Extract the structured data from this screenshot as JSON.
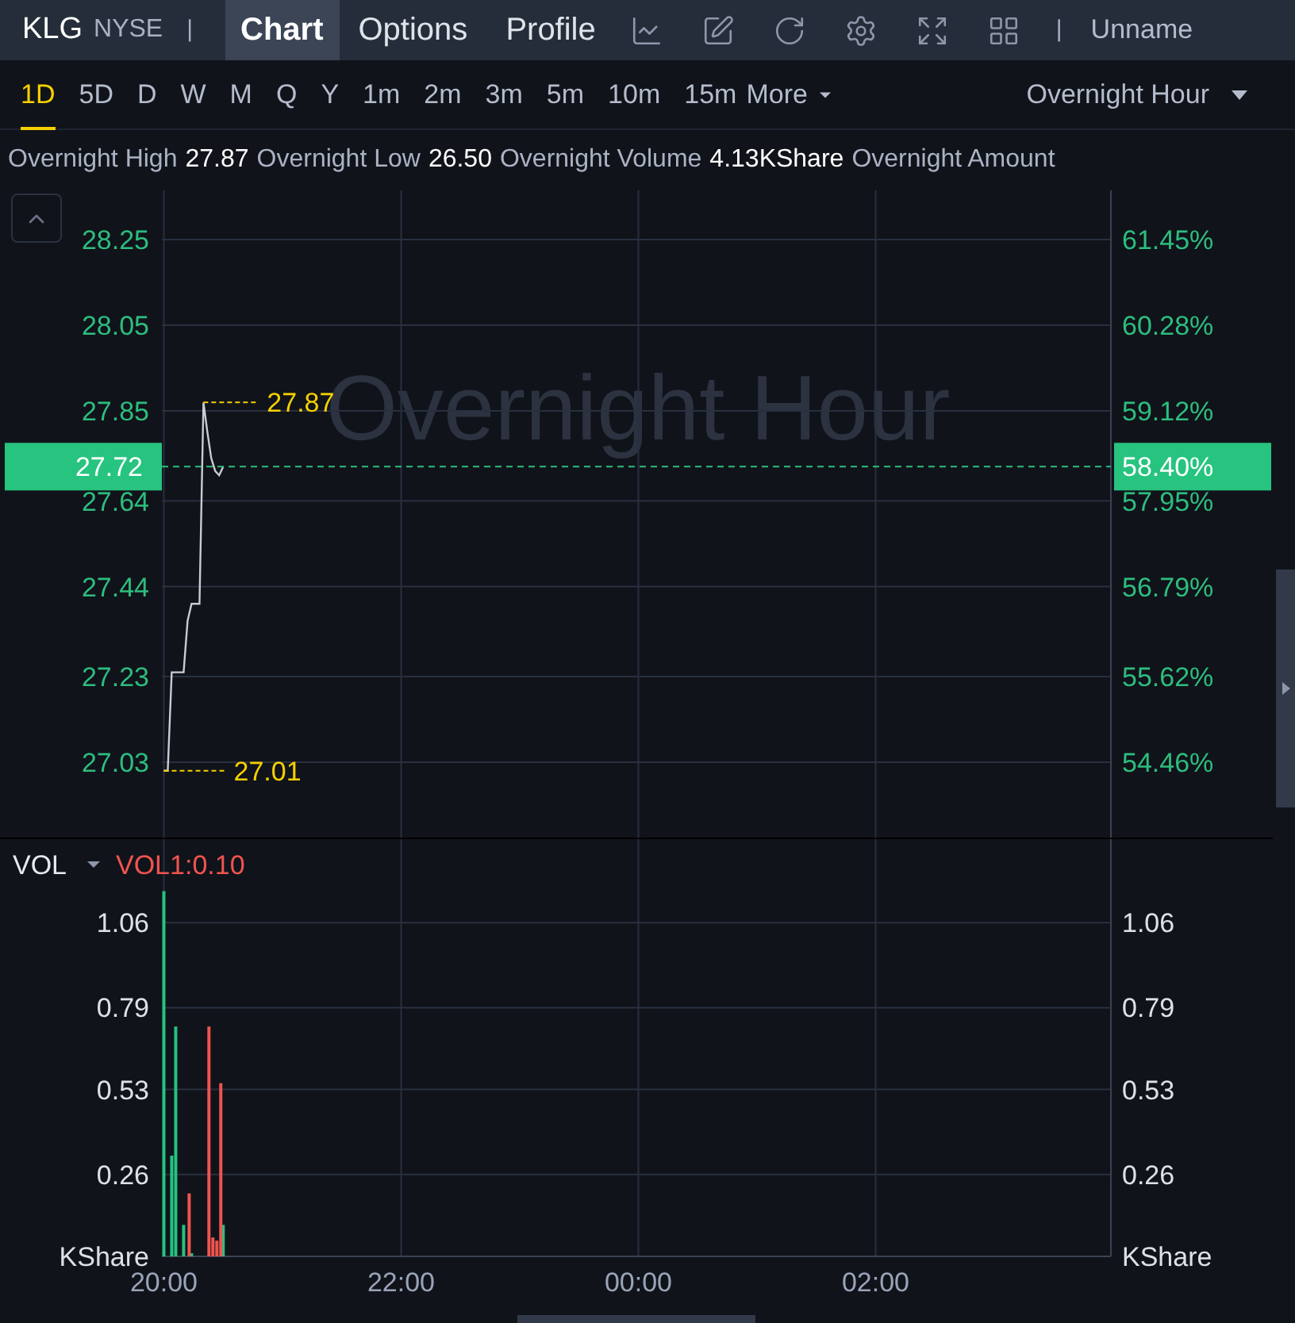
{
  "header": {
    "symbol": "KLG",
    "exchange": "NYSE",
    "separator": "|",
    "tabs": [
      {
        "label": "Chart",
        "selected": true
      },
      {
        "label": "Options",
        "selected": false
      },
      {
        "label": "Profile",
        "selected": false
      }
    ],
    "separator_2": "|",
    "layout_name": "Unname"
  },
  "periods": [
    {
      "label": "1D",
      "selected": true
    },
    {
      "label": "5D",
      "selected": false
    },
    {
      "label": "D",
      "selected": false
    },
    {
      "label": "W",
      "selected": false
    },
    {
      "label": "M",
      "selected": false
    },
    {
      "label": "Q",
      "selected": false
    },
    {
      "label": "Y",
      "selected": false
    },
    {
      "label": "1m",
      "selected": false
    },
    {
      "label": "2m",
      "selected": false
    },
    {
      "label": "3m",
      "selected": false
    },
    {
      "label": "5m",
      "selected": false
    },
    {
      "label": "10m",
      "selected": false
    },
    {
      "label": "15m",
      "selected": false
    }
  ],
  "more": {
    "label": "More"
  },
  "session_select": {
    "value": "Overnight Hour"
  },
  "stats": [
    {
      "label": "Overnight High",
      "value": "27.87"
    },
    {
      "label": "Overnight Low",
      "value": "26.50"
    },
    {
      "label": "Overnight Volume",
      "value": "4.13KShare"
    },
    {
      "label": "Overnight Amount"
    }
  ],
  "price_panel": {
    "watermark": "Overnight Hour",
    "percent_labels": [
      "61.45%",
      "60.28%",
      "59.12%",
      "57.95%",
      "56.79%",
      "55.62%",
      "54.46%"
    ],
    "chart_data": {
      "type": "line",
      "categories": [
        null,
        null,
        null,
        null,
        null,
        null,
        null,
        null,
        null,
        null,
        null,
        null,
        null,
        null,
        null,
        null,
        null,
        null,
        null,
        null,
        null,
        null,
        null,
        null,
        null,
        null,
        null,
        null,
        null,
        null,
        null,
        null,
        null,
        null,
        null,
        null,
        null,
        null,
        null,
        null,
        null,
        null,
        null,
        null,
        null,
        null,
        null,
        null,
        null,
        null,
        null,
        null,
        null,
        null,
        null,
        null,
        null,
        null,
        null,
        null,
        null,
        null,
        null,
        null,
        null,
        null,
        null,
        null,
        null,
        null,
        null,
        null,
        null,
        null,
        null,
        null,
        null,
        null,
        null,
        null,
        null,
        null,
        null,
        null,
        null,
        null,
        null,
        null,
        null,
        null,
        null,
        null,
        null,
        null,
        null,
        null,
        null,
        null,
        null,
        null,
        null,
        null,
        null,
        null,
        null,
        null,
        null,
        null,
        null,
        null,
        null,
        null,
        null,
        null,
        null,
        null,
        null,
        null,
        null,
        null,
        null,
        null,
        null,
        null,
        null,
        null,
        null,
        null,
        null,
        null,
        null,
        null,
        null,
        null,
        null,
        null,
        null,
        null,
        null,
        null,
        null,
        null,
        null,
        null,
        null,
        null,
        null,
        null,
        null,
        null,
        null,
        null,
        null,
        null,
        null,
        null,
        null,
        null,
        null,
        null,
        null,
        null,
        null,
        null,
        null,
        null,
        null,
        null,
        null,
        null,
        null,
        null,
        null,
        null,
        null,
        null,
        null,
        null,
        null,
        null,
        null,
        null,
        null,
        null,
        null,
        null,
        null,
        null,
        null,
        null,
        null,
        null,
        null,
        null,
        null,
        null,
        null,
        null,
        null,
        null,
        null,
        null,
        null,
        null,
        null,
        null,
        null,
        null,
        null,
        null,
        null,
        null,
        null,
        null,
        null,
        null,
        null,
        null,
        null,
        null,
        null,
        null,
        null,
        null,
        null,
        null,
        null,
        null,
        null,
        null,
        null,
        null,
        null,
        null,
        null,
        null,
        null,
        null,
        null,
        null
      ],
      "series": [
        {
          "color": "#c8ccd4",
          "values": [
            27.01,
            27.01,
            27.24,
            27.24,
            27.24,
            27.24,
            27.36,
            27.4,
            27.4,
            27.4,
            27.87,
            27.8,
            27.74,
            27.71,
            27.7,
            27.72,
            null,
            null,
            null,
            null,
            null,
            null,
            null,
            null,
            null,
            null,
            null,
            null,
            null,
            null,
            null,
            null,
            null,
            null,
            null,
            null,
            null,
            null,
            null,
            null,
            null,
            null,
            null,
            null,
            null,
            null,
            null,
            null,
            null,
            null,
            null,
            null,
            null,
            null,
            null,
            null,
            null,
            null,
            null,
            null,
            null,
            null,
            null,
            null,
            null,
            null,
            null,
            null,
            null,
            null,
            null,
            null,
            null,
            null,
            null,
            null,
            null,
            null,
            null,
            null,
            null,
            null,
            null,
            null,
            null,
            null,
            null,
            null,
            null,
            null,
            null,
            null,
            null,
            null,
            null,
            null,
            null,
            null,
            null,
            null,
            null,
            null,
            null,
            null,
            null,
            null,
            null,
            null,
            null,
            null,
            null,
            null,
            null,
            null,
            null,
            null,
            null,
            null,
            null,
            null,
            null,
            null,
            null,
            null,
            null,
            null,
            null,
            null,
            null,
            null,
            null,
            null,
            null,
            null,
            null,
            null,
            null,
            null,
            null,
            null,
            null,
            null,
            null,
            null,
            null,
            null,
            null,
            null,
            null,
            null,
            null,
            null,
            null,
            null,
            null,
            null,
            null,
            null,
            null,
            null,
            null,
            null,
            null,
            null,
            null,
            null,
            null,
            null,
            null,
            null,
            null,
            null,
            null,
            null,
            null,
            null,
            null,
            null,
            null,
            null,
            null,
            null,
            null,
            null,
            null,
            null,
            null,
            null,
            null,
            null,
            null,
            null,
            null,
            null,
            null,
            null,
            null,
            null,
            null,
            null,
            null,
            null,
            null,
            null,
            null,
            null,
            null,
            null,
            null,
            null,
            null,
            null,
            null,
            null,
            null,
            null,
            null,
            null,
            null,
            null,
            null,
            null,
            null,
            null,
            null,
            null,
            null,
            null,
            null,
            null,
            null,
            null,
            null,
            null,
            null,
            null,
            null,
            null,
            null,
            null
          ]
        }
      ],
      "ylim": [
        26.854,
        28.365
      ],
      "yticks": [
        28.25,
        28.05,
        27.85,
        27.64,
        27.44,
        27.23,
        27.03
      ],
      "grid": true,
      "ref_lines": [
        {
          "axis": "y",
          "value": 27.72,
          "color": "#2dbd7e"
        }
      ]
    },
    "high_label": "27.87",
    "low_label": "27.01",
    "last_price": "27.72",
    "last_percent": "58.40%"
  },
  "volume_panel": {
    "indicator": "VOL",
    "parameter": "VOL1:0.10",
    "unit_left": "KShare",
    "unit_right": "KShare",
    "left_labels": [
      "1.06",
      "0.79",
      "0.53",
      "0.26"
    ],
    "right_labels": [
      "1.06",
      "0.79",
      "0.53",
      "0.26"
    ],
    "chart_data": {
      "type": "bar",
      "categories": [
        "20:00",
        null,
        null,
        null,
        null,
        null,
        null,
        null,
        null,
        null,
        null,
        null,
        null,
        null,
        null,
        null,
        null,
        null,
        null,
        null,
        null,
        null,
        null,
        null,
        null,
        null,
        null,
        null,
        null,
        null,
        null,
        null,
        null,
        null,
        null,
        null,
        null,
        null,
        null,
        null,
        null,
        null,
        null,
        null,
        null,
        null,
        null,
        null,
        null,
        null,
        null,
        null,
        null,
        null,
        null,
        null,
        null,
        null,
        null,
        null,
        "22:00",
        null,
        null,
        null,
        null,
        null,
        null,
        null,
        null,
        null,
        null,
        null,
        null,
        null,
        null,
        null,
        null,
        null,
        null,
        null,
        null,
        null,
        null,
        null,
        null,
        null,
        null,
        null,
        null,
        null,
        null,
        null,
        null,
        null,
        null,
        null,
        null,
        null,
        null,
        null,
        null,
        null,
        null,
        null,
        null,
        null,
        null,
        null,
        null,
        null,
        null,
        null,
        null,
        null,
        null,
        null,
        null,
        null,
        null,
        null,
        "00:00",
        null,
        null,
        null,
        null,
        null,
        null,
        null,
        null,
        null,
        null,
        null,
        null,
        null,
        null,
        null,
        null,
        null,
        null,
        null,
        null,
        null,
        null,
        null,
        null,
        null,
        null,
        null,
        null,
        null,
        null,
        null,
        null,
        null,
        null,
        null,
        null,
        null,
        null,
        null,
        null,
        null,
        null,
        null,
        null,
        null,
        null,
        null,
        null,
        null,
        null,
        null,
        null,
        null,
        null,
        null,
        null,
        null,
        null,
        null,
        "02:00",
        null,
        null,
        null,
        null,
        null,
        null,
        null,
        null,
        null,
        null,
        null,
        null,
        null,
        null,
        null,
        null,
        null,
        null,
        null,
        null,
        null,
        null,
        null,
        null,
        null,
        null,
        null,
        null,
        null,
        null,
        null,
        null,
        null,
        null,
        null,
        null,
        null,
        null,
        null,
        null,
        null,
        null,
        null,
        null,
        null,
        null,
        null,
        null,
        null,
        null,
        null,
        null,
        null,
        null,
        null,
        null,
        null,
        null,
        null
      ],
      "series": [
        {
          "color": "#26c281",
          "values": [
            1.16,
            null,
            0.32,
            0.73,
            null,
            0.1,
            null,
            0.01,
            null,
            null,
            null,
            null,
            null,
            null,
            null,
            0.1,
            null,
            null,
            null,
            null,
            null,
            null,
            null,
            null,
            null,
            null,
            null,
            null,
            null,
            null,
            null,
            null,
            null,
            null,
            null,
            null,
            null,
            null,
            null,
            null,
            null,
            null,
            null,
            null,
            null,
            null,
            null,
            null,
            null,
            null,
            null,
            null,
            null,
            null,
            null,
            null,
            null,
            null,
            null,
            null,
            null,
            null,
            null,
            null,
            null,
            null,
            null,
            null,
            null,
            null,
            null,
            null,
            null,
            null,
            null,
            null,
            null,
            null,
            null,
            null,
            null,
            null,
            null,
            null,
            null,
            null,
            null,
            null,
            null,
            null,
            null,
            null,
            null,
            null,
            null,
            null,
            null,
            null,
            null,
            null,
            null,
            null,
            null,
            null,
            null,
            null,
            null,
            null,
            null,
            null,
            null,
            null,
            null,
            null,
            null,
            null,
            null,
            null,
            null,
            null,
            null,
            null,
            null,
            null,
            null,
            null,
            null,
            null,
            null,
            null,
            null,
            null,
            null,
            null,
            null,
            null,
            null,
            null,
            null,
            null,
            null,
            null,
            null,
            null,
            null,
            null,
            null,
            null,
            null,
            null,
            null,
            null,
            null,
            null,
            null,
            null,
            null,
            null,
            null,
            null,
            null,
            null,
            null,
            null,
            null,
            null,
            null,
            null,
            null,
            null,
            null,
            null,
            null,
            null,
            null,
            null,
            null,
            null,
            null,
            null,
            null,
            null,
            null,
            null,
            null,
            null,
            null,
            null,
            null,
            null,
            null,
            null,
            null,
            null,
            null,
            null,
            null,
            null,
            null,
            null,
            null,
            null,
            null,
            null,
            null,
            null,
            null,
            null,
            null,
            null,
            null,
            null,
            null,
            null,
            null,
            null,
            null,
            null,
            null,
            null,
            null,
            null,
            null,
            null,
            null,
            null,
            null,
            null,
            null,
            null,
            null,
            null,
            null,
            null,
            null,
            null,
            null,
            null,
            null,
            null
          ]
        },
        {
          "color": "#f0544f",
          "values": [
            null,
            null,
            null,
            null,
            null,
            null,
            0.2,
            null,
            null,
            null,
            null,
            0.73,
            0.06,
            0.05,
            0.55,
            null,
            null,
            null,
            null,
            null,
            null,
            null,
            null,
            null,
            null,
            null,
            null,
            null,
            null,
            null,
            null,
            null,
            null,
            null,
            null,
            null,
            null,
            null,
            null,
            null,
            null,
            null,
            null,
            null,
            null,
            null,
            null,
            null,
            null,
            null,
            null,
            null,
            null,
            null,
            null,
            null,
            null,
            null,
            null,
            null,
            null,
            null,
            null,
            null,
            null,
            null,
            null,
            null,
            null,
            null,
            null,
            null,
            null,
            null,
            null,
            null,
            null,
            null,
            null,
            null,
            null,
            null,
            null,
            null,
            null,
            null,
            null,
            null,
            null,
            null,
            null,
            null,
            null,
            null,
            null,
            null,
            null,
            null,
            null,
            null,
            null,
            null,
            null,
            null,
            null,
            null,
            null,
            null,
            null,
            null,
            null,
            null,
            null,
            null,
            null,
            null,
            null,
            null,
            null,
            null,
            null,
            null,
            null,
            null,
            null,
            null,
            null,
            null,
            null,
            null,
            null,
            null,
            null,
            null,
            null,
            null,
            null,
            null,
            null,
            null,
            null,
            null,
            null,
            null,
            null,
            null,
            null,
            null,
            null,
            null,
            null,
            null,
            null,
            null,
            null,
            null,
            null,
            null,
            null,
            null,
            null,
            null,
            null,
            null,
            null,
            null,
            null,
            null,
            null,
            null,
            null,
            null,
            null,
            null,
            null,
            null,
            null,
            null,
            null,
            null,
            null,
            null,
            null,
            null,
            null,
            null,
            null,
            null,
            null,
            null,
            null,
            null,
            null,
            null,
            null,
            null,
            null,
            null,
            null,
            null,
            null,
            null,
            null,
            null,
            null,
            null,
            null,
            null,
            null,
            null,
            null,
            null,
            null,
            null,
            null,
            null,
            null,
            null,
            null,
            null,
            null,
            null,
            null,
            null,
            null,
            null,
            null,
            null,
            null,
            null,
            null,
            null,
            null,
            null,
            null,
            null,
            null,
            null,
            null,
            null
          ]
        }
      ],
      "ylim": [
        0,
        1.33
      ],
      "yticks": [
        1.06,
        0.79,
        0.53,
        0.26
      ],
      "grid": true
    }
  }
}
